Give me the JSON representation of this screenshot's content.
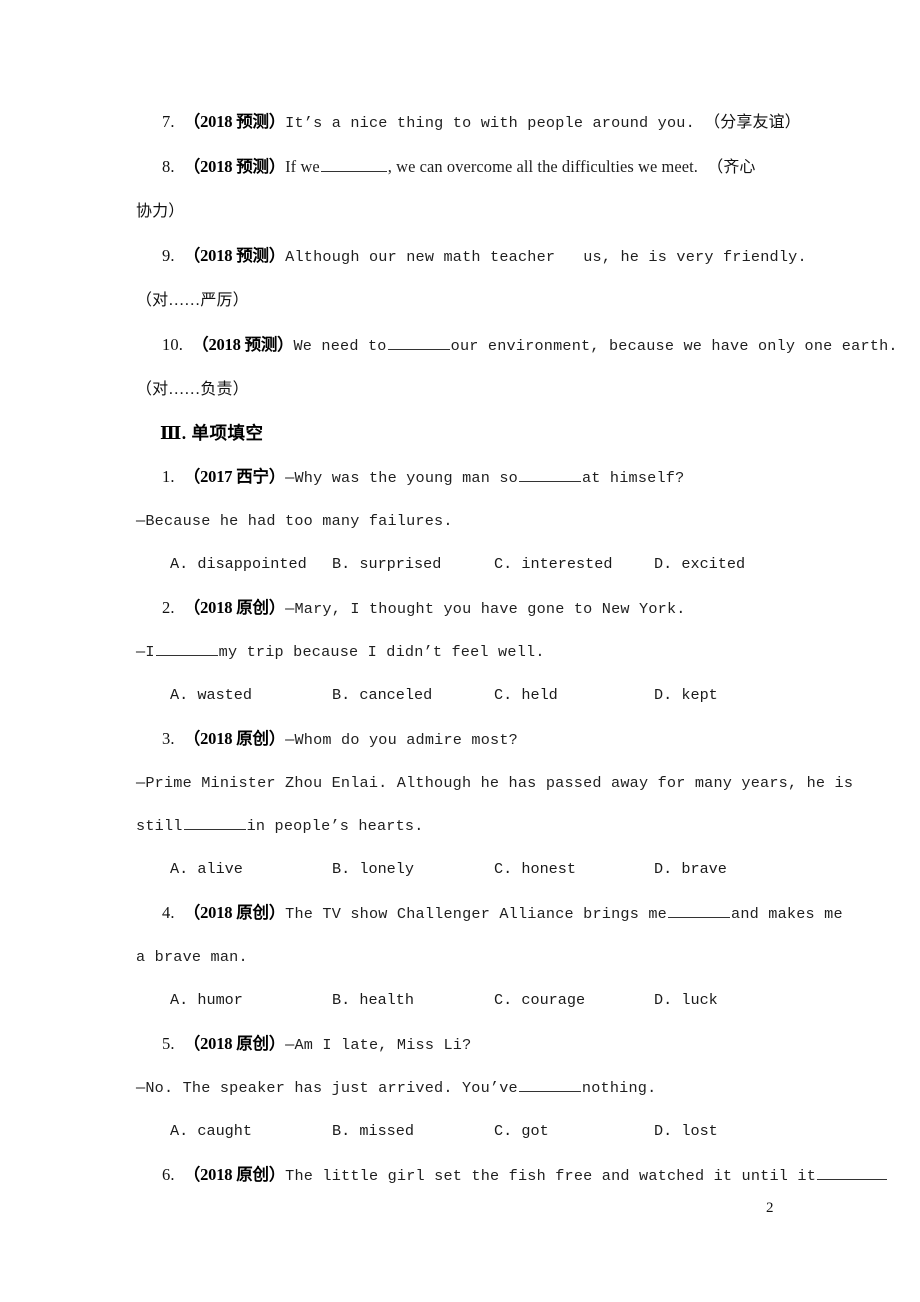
{
  "page": {
    "number": "2",
    "language": "zh-CN / en"
  },
  "fill_in_items": [
    {
      "num": "7.",
      "tag": "（2018 预测）",
      "text_before": "It’s a nice thing to with people around you.",
      "hint": "（分享友谊）",
      "style": "mono"
    },
    {
      "num": "8.",
      "tag": "（2018 预测）",
      "text_before": "If we",
      "text_after": ", we can overcome all the difficulties we meet.",
      "hint_head": "（齐心",
      "hint_tail": "协力）",
      "style": "serif"
    },
    {
      "num": "9.",
      "tag": "（2018 预测）",
      "text_before": "Although  our  new  math  teacher",
      "text_after": "us,  he  is  very  friendly.",
      "hint": "（对……严厉）",
      "style": "mono"
    },
    {
      "num": "10.",
      "tag": "（2018 预测）",
      "text_before": "We need to",
      "text_after": "our environment, because we have only one earth.",
      "hint": "（对……负责）",
      "style": "mono"
    }
  ],
  "section": {
    "label": "Ⅲ.  单项填空"
  },
  "choice_items": [
    {
      "num": "1.",
      "tag": "（2017 西宁）",
      "lines": [
        {
          "text_before": "—Why was the young man so",
          "text_after": "at himself?"
        },
        {
          "text_before": "—Because he had too many failures."
        }
      ],
      "options": {
        "A": "A. disappointed",
        "B": "B. surprised",
        "C": "C. interested",
        "D": "D. excited"
      }
    },
    {
      "num": "2.",
      "tag": "（2018 原创）",
      "lines": [
        {
          "text_before": "—Mary, I thought you have gone to New York."
        },
        {
          "text_before": "—I",
          "text_after": "my trip because I didn’t feel well."
        }
      ],
      "options": {
        "A": "A. wasted",
        "B": "B. canceled",
        "C": "C. held",
        "D": "D. kept"
      }
    },
    {
      "num": "3.",
      "tag": "（2018 原创）",
      "lines": [
        {
          "text_before": "—Whom do you admire most?"
        },
        {
          "text_before": "—Prime Minister Zhou Enlai. Although he has passed away for many years, he is"
        },
        {
          "text_before": "still",
          "text_after": "in people’s hearts."
        }
      ],
      "options": {
        "A": "A. alive",
        "B": "B. lonely",
        "C": "C. honest",
        "D": "D. brave"
      }
    },
    {
      "num": "4.",
      "tag": "（2018 原创）",
      "lines": [
        {
          "text_before": "The TV show Challenger Alliance brings me",
          "text_after": "and makes me"
        },
        {
          "text_before": "a brave man."
        }
      ],
      "options": {
        "A": "A. humor",
        "B": "B. health",
        "C": "C. courage",
        "D": "D. luck"
      }
    },
    {
      "num": "5.",
      "tag": "（2018 原创）",
      "lines": [
        {
          "text_before": "—Am I late, Miss Li?"
        },
        {
          "text_before": "—No. The speaker has just arrived. You’ve",
          "text_after": "nothing."
        }
      ],
      "options": {
        "A": "A. caught",
        "B": "B. missed",
        "C": "C. got",
        "D": "D. lost"
      }
    },
    {
      "num": "6.",
      "tag": "（2018 原创）",
      "lines": [
        {
          "text_before": "The little girl set the fish free and watched it until it",
          "text_after": ""
        }
      ]
    }
  ]
}
